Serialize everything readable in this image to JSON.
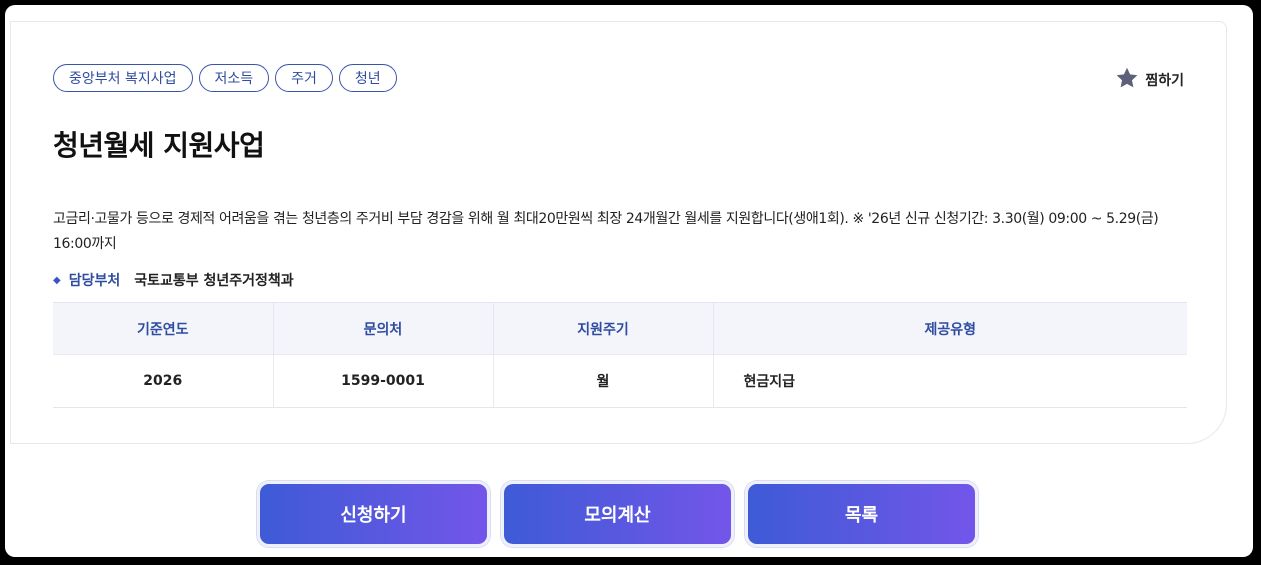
{
  "tags": [
    "중앙부처 복지사업",
    "저소득",
    "주거",
    "청년"
  ],
  "favorite_label": "찜하기",
  "title": "청년월세 지원사업",
  "description": "고금리·고물가 등으로 경제적 어려움을 겪는 청년층의 주거비 부담 경감을 위해 월 최대20만원씩 최장 24개월간 월세를 지원합니다(생애1회). ※ '26년 신규 신청기간: 3.30(월) 09:00 ~ 5.29(금) 16:00까지",
  "department": {
    "label": "담당부처",
    "value": "국토교통부 청년주거정책과"
  },
  "table": {
    "headers": [
      "기준연도",
      "문의처",
      "지원주기",
      "제공유형"
    ],
    "row": [
      "2026",
      "1599-0001",
      "월",
      "현금지급"
    ]
  },
  "buttons": {
    "apply": "신청하기",
    "simulate": "모의계산",
    "list": "목록"
  },
  "colors": {
    "accent": "#2f4c9f",
    "button_start": "#3e5bd6",
    "button_end": "#7356ea"
  }
}
